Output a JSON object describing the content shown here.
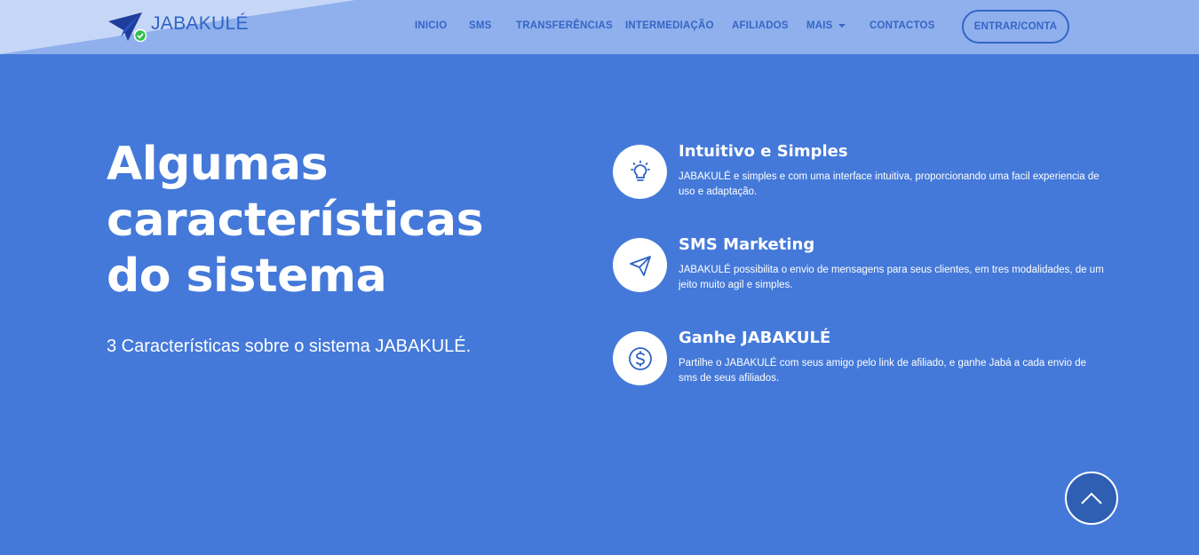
{
  "brand": {
    "name": "JABAKULÉ"
  },
  "nav": {
    "items": [
      {
        "label": "INICIO"
      },
      {
        "label": "SMS"
      },
      {
        "label": "TRANSFERÊNCIAS"
      },
      {
        "label": "INTERMEDIAÇÃO"
      },
      {
        "label": "AFILIADOS"
      },
      {
        "label": "MAIS"
      },
      {
        "label": "CONTACTOS"
      }
    ],
    "login_label": "ENTRAR/CONTA"
  },
  "hero": {
    "title_lines": [
      "Algumas",
      "características",
      "do sistema"
    ],
    "subtitle": "3 Características sobre o sistema JABAKULÉ."
  },
  "features": [
    {
      "icon": "lightbulb-icon",
      "title": "Intuitivo e Simples",
      "description": "JABAKULÉ e simples e com uma interface intuitiva, proporcionando uma facil experiencia de uso e adaptação."
    },
    {
      "icon": "paper-plane-icon",
      "title": "SMS Marketing",
      "description": "JABAKULÉ possibilita o envio de mensagens para seus clientes, em tres modalidades, de um jeito muito agil e simples."
    },
    {
      "icon": "dollar-coin-icon",
      "title": "Ganhe JABAKULÉ",
      "description": "Partilhe o JABAKULÉ com seus amigo pelo link de afiliado, e ganhe Jabá a cada envio de sms de seus afiliados."
    }
  ],
  "colors": {
    "background": "#4479d9",
    "header": "#8fb0ec",
    "accent": "#3565c6",
    "text_light": "#ffffff"
  }
}
